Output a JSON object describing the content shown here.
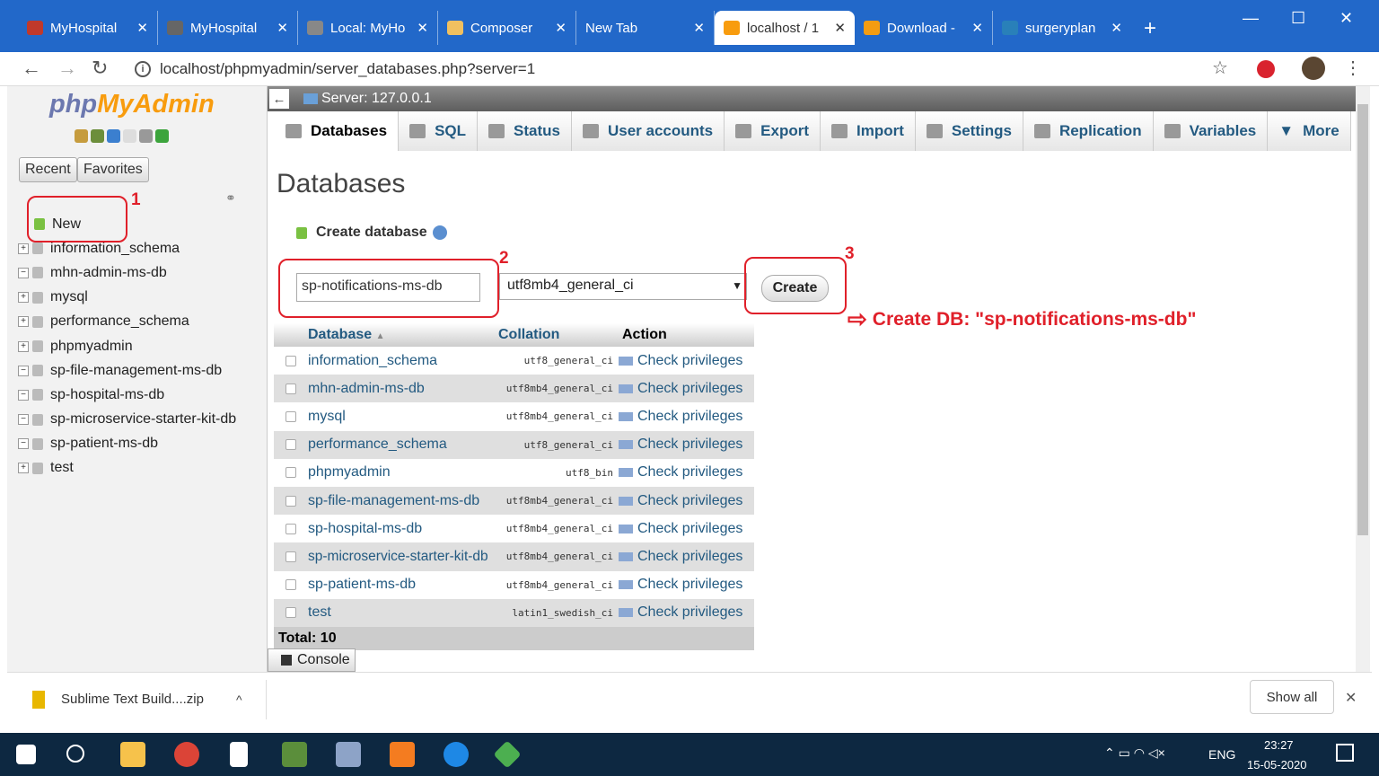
{
  "browser": {
    "tabs": [
      {
        "label": "MyHospital",
        "color": "#c0392b"
      },
      {
        "label": "MyHospital",
        "color": "#666666"
      },
      {
        "label": "Local: MyHo",
        "color": "#888888"
      },
      {
        "label": "Composer",
        "color": "#f0c060"
      },
      {
        "label": "New Tab",
        "color": ""
      },
      {
        "label": "localhost / 1",
        "color": "#f89c0e"
      },
      {
        "label": "Download -",
        "color": "#f39c12"
      },
      {
        "label": "surgeryplan",
        "color": "#2980b9"
      }
    ],
    "new_tab_label": "+",
    "url": "localhost/phpmyadmin/server_databases.php?server=1"
  },
  "sidebar": {
    "logo_a": "php",
    "logo_b": "MyAdmin",
    "recent_label": "Recent",
    "favorites_label": "Favorites",
    "new_label": "New",
    "databases": [
      "information_schema",
      "mhn-admin-ms-db",
      "mysql",
      "performance_schema",
      "phpmyadmin",
      "sp-file-management-ms-db",
      "sp-hospital-ms-db",
      "sp-microservice-starter-kit-db",
      "sp-patient-ms-db",
      "test"
    ]
  },
  "main": {
    "server_label": "Server: 127.0.0.1",
    "tabs": [
      "Databases",
      "SQL",
      "Status",
      "User accounts",
      "Export",
      "Import",
      "Settings",
      "Replication",
      "Variables",
      "More"
    ],
    "heading": "Databases",
    "create_label": "Create database",
    "db_name_value": "sp-notifications-ms-db",
    "collation_value": "utf8mb4_general_ci",
    "create_button": "Create",
    "table_headers": {
      "database": "Database",
      "collation": "Collation",
      "action": "Action"
    },
    "rows": [
      {
        "name": "information_schema",
        "collation": "utf8_general_ci"
      },
      {
        "name": "mhn-admin-ms-db",
        "collation": "utf8mb4_general_ci"
      },
      {
        "name": "mysql",
        "collation": "utf8mb4_general_ci"
      },
      {
        "name": "performance_schema",
        "collation": "utf8_general_ci"
      },
      {
        "name": "phpmyadmin",
        "collation": "utf8_bin"
      },
      {
        "name": "sp-file-management-ms-db",
        "collation": "utf8mb4_general_ci"
      },
      {
        "name": "sp-hospital-ms-db",
        "collation": "utf8mb4_general_ci"
      },
      {
        "name": "sp-microservice-starter-kit-db",
        "collation": "utf8mb4_general_ci"
      },
      {
        "name": "sp-patient-ms-db",
        "collation": "utf8mb4_general_ci"
      },
      {
        "name": "test",
        "collation": "latin1_swedish_ci"
      }
    ],
    "action_label": "Check privileges",
    "total": "Total: 10",
    "console_label": "Console"
  },
  "annotations": {
    "n1": "1",
    "n2": "2",
    "n3": "3",
    "text": "Create DB: \"sp-notifications-ms-db\""
  },
  "downloads": {
    "file": "Sublime Text Build....zip",
    "show_all": "Show all"
  },
  "taskbar": {
    "lang": "ENG",
    "time": "23:27",
    "date": "15-05-2020"
  }
}
